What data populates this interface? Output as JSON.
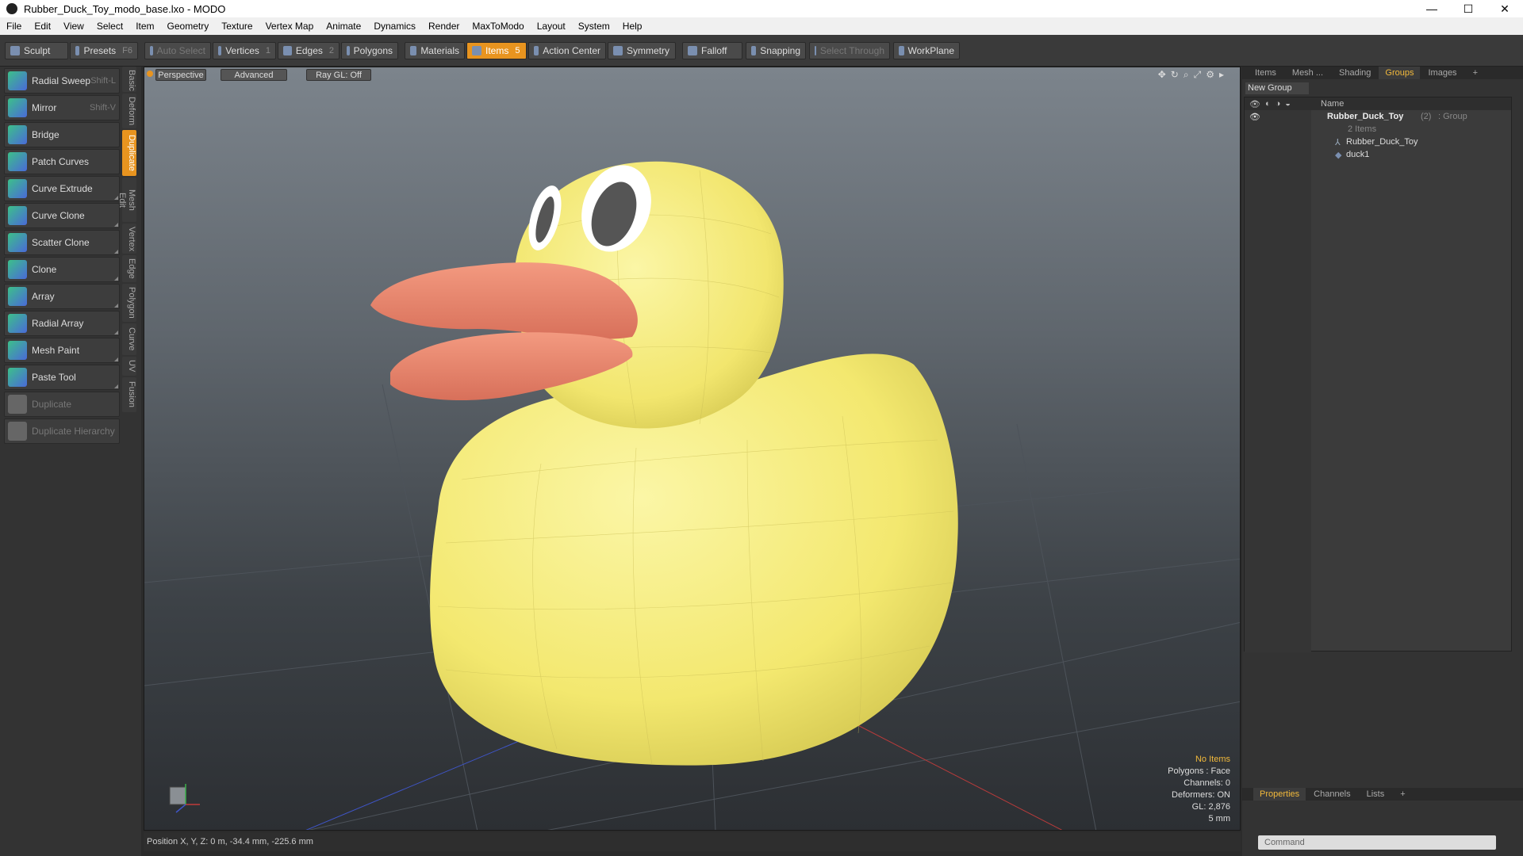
{
  "window": {
    "title": "Rubber_Duck_Toy_modo_base.lxo - MODO",
    "minimize": "—",
    "maximize": "☐",
    "close": "✕"
  },
  "menu": [
    "File",
    "Edit",
    "View",
    "Select",
    "Item",
    "Geometry",
    "Texture",
    "Vertex Map",
    "Animate",
    "Dynamics",
    "Render",
    "MaxToModo",
    "Layout",
    "System",
    "Help"
  ],
  "toolbar": {
    "sculpt": "Sculpt",
    "presets": "Presets",
    "presets_key": "F6",
    "auto_select": "Auto Select",
    "vertices": "Vertices",
    "vertices_key": "1",
    "edges": "Edges",
    "edges_key": "2",
    "polygons": "Polygons",
    "materials": "Materials",
    "items": "Items",
    "items_key": "5",
    "action_center": "Action Center",
    "symmetry": "Symmetry",
    "falloff": "Falloff",
    "snapping": "Snapping",
    "select_through": "Select Through",
    "workplane": "WorkPlane"
  },
  "tools": [
    {
      "label": "Radial Sweep",
      "shortcut": "Shift-L"
    },
    {
      "label": "Mirror",
      "shortcut": "Shift-V"
    },
    {
      "label": "Bridge",
      "shortcut": ""
    },
    {
      "label": "Patch Curves",
      "shortcut": ""
    },
    {
      "label": "Curve Extrude",
      "shortcut": ""
    },
    {
      "label": "Curve Clone",
      "shortcut": ""
    },
    {
      "label": "Scatter Clone",
      "shortcut": ""
    },
    {
      "label": "Clone",
      "shortcut": ""
    },
    {
      "label": "Array",
      "shortcut": ""
    },
    {
      "label": "Radial Array",
      "shortcut": ""
    },
    {
      "label": "Mesh Paint",
      "shortcut": ""
    },
    {
      "label": "Paste Tool",
      "shortcut": ""
    },
    {
      "label": "Duplicate",
      "shortcut": ""
    },
    {
      "label": "Duplicate Hierarchy",
      "shortcut": ""
    }
  ],
  "vtabs": [
    "Basic",
    "Deform",
    "Duplicate",
    "Mesh Edit",
    "Vertex",
    "Edge",
    "Polygon",
    "Curve",
    "UV",
    "Fusion"
  ],
  "viewport": {
    "perspective": "Perspective",
    "advanced": "Advanced",
    "raygl": "Ray GL: Off"
  },
  "status": {
    "no_items": "No Items",
    "polygons": "Polygons : Face",
    "channels": "Channels: 0",
    "deformers": "Deformers: ON",
    "gl": "GL: 2,876",
    "size": "5 mm"
  },
  "position": "Position X, Y, Z:   0 m, -34.4 mm, -225.6 mm",
  "right_tabs": [
    "Items",
    "Mesh ...",
    "Shading",
    "Groups",
    "Images"
  ],
  "new_group": "New Group",
  "tree": {
    "header": "Name",
    "group_name": "Rubber_Duck_Toy",
    "group_count": "(2)",
    "group_type": ": Group",
    "sub": "2 Items",
    "children": [
      "Rubber_Duck_Toy",
      "duck1"
    ]
  },
  "bottom_tabs": [
    "Properties",
    "Channels",
    "Lists"
  ],
  "command": "Command",
  "colors": {
    "accent": "#e8941f",
    "duck_body": "#f6ec83",
    "beak": "#e8826a"
  }
}
